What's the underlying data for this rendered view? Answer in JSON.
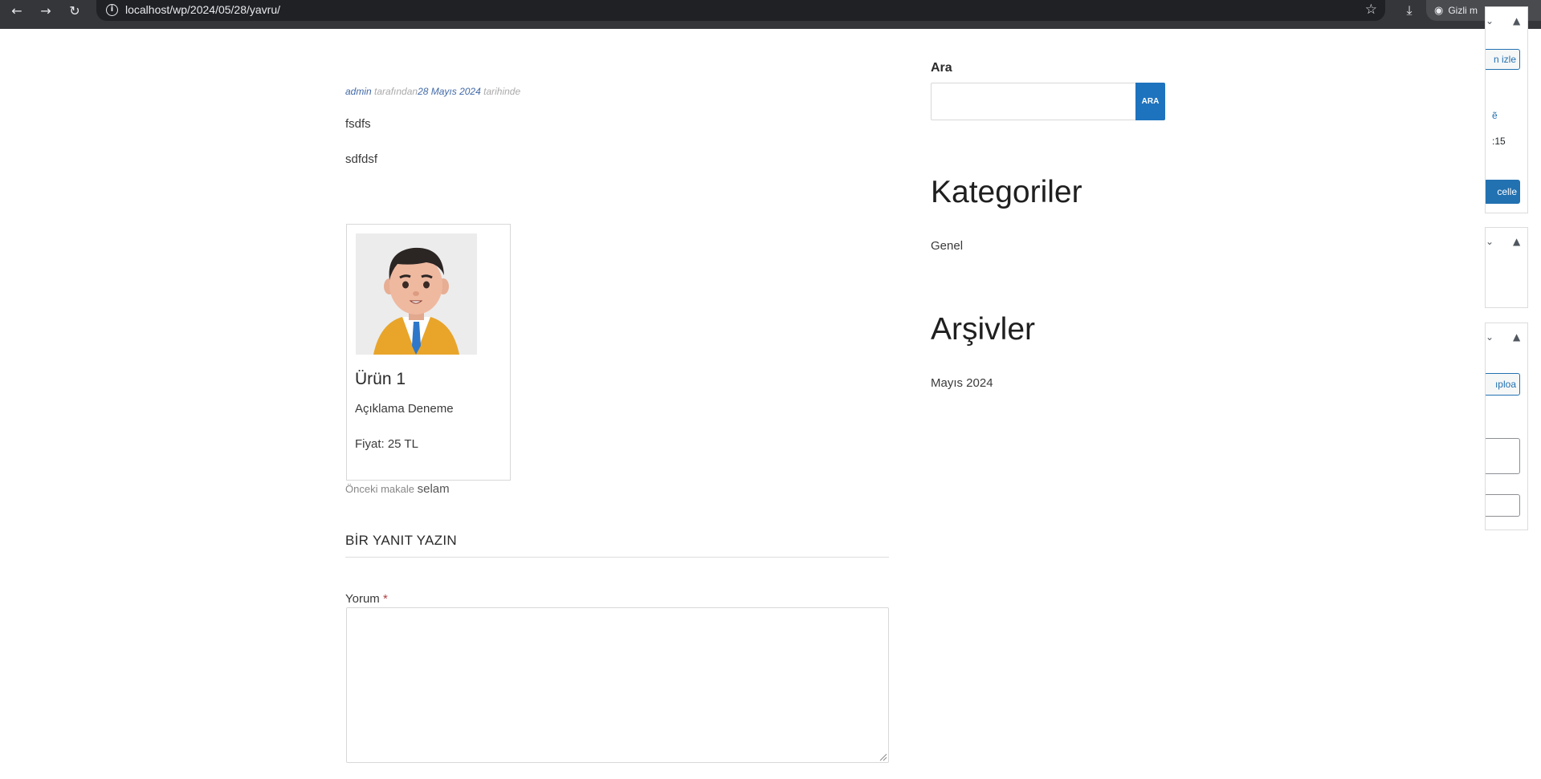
{
  "browser": {
    "url": "localhost/wp/2024/05/28/yavru/",
    "incognito_label": "Gizli m"
  },
  "post": {
    "author": "admin",
    "by_text": " tarafından",
    "date": "28 Mayıs 2024",
    "on_text": " tarihinde",
    "paragraphs": [
      "fsdfs",
      "sdfdsf"
    ]
  },
  "product": {
    "title": "Ürün 1",
    "description": "Açıklama Deneme",
    "price": "Fiyat: 25 TL"
  },
  "navigation": {
    "prev_label": "Önceki makale",
    "prev_title": "selam"
  },
  "comment": {
    "heading": "BİR YANIT YAZIN",
    "label": "Yorum",
    "required_mark": "*"
  },
  "sidebar": {
    "search_title": "Ara",
    "search_button": "ARA",
    "categories_title": "Kategoriler",
    "categories": [
      "Genel"
    ],
    "archives_title": "Arşivler",
    "archives": [
      "Mayıs 2024"
    ]
  },
  "admin_panel": {
    "watch_button": "n izle",
    "link_fragment": "ẽ",
    "time_fragment": ":15",
    "update_button": "celle",
    "upload_button": "ıploa"
  }
}
